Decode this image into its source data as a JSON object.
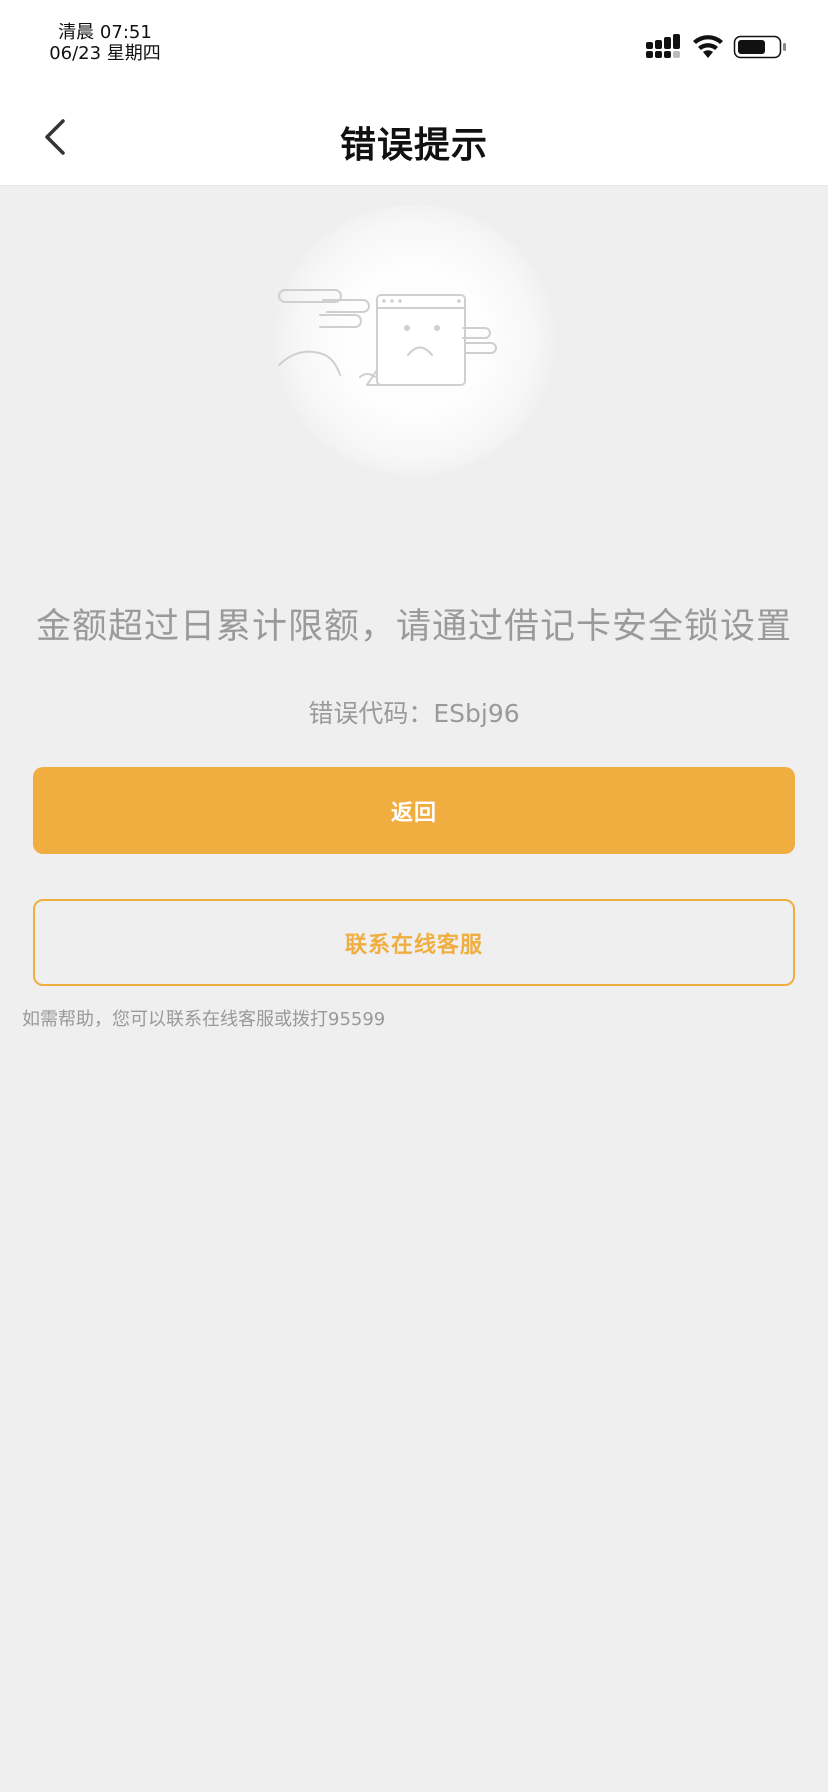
{
  "status_bar": {
    "time": "清晨 07:51",
    "date": "06/23 星期四",
    "icons": [
      "signal-icon",
      "wifi-icon",
      "battery-icon"
    ],
    "battery_level": 0.65
  },
  "nav": {
    "title": "错误提示",
    "back_icon": "chevron-left-icon"
  },
  "illustration": {
    "icon": "sad-window-icon"
  },
  "error": {
    "message": "金额超过日累计限额，请通过借记卡安全锁设置",
    "code": "错误代码：ESbj96"
  },
  "actions": {
    "back_label": "返回",
    "contact_label": "联系在线客服"
  },
  "help": {
    "text": "如需帮助，您可以联系在线客服或拨打95599"
  },
  "colors": {
    "accent": "#f0ae41",
    "background": "#efefef",
    "secondary_text": "#9a9a9a"
  }
}
